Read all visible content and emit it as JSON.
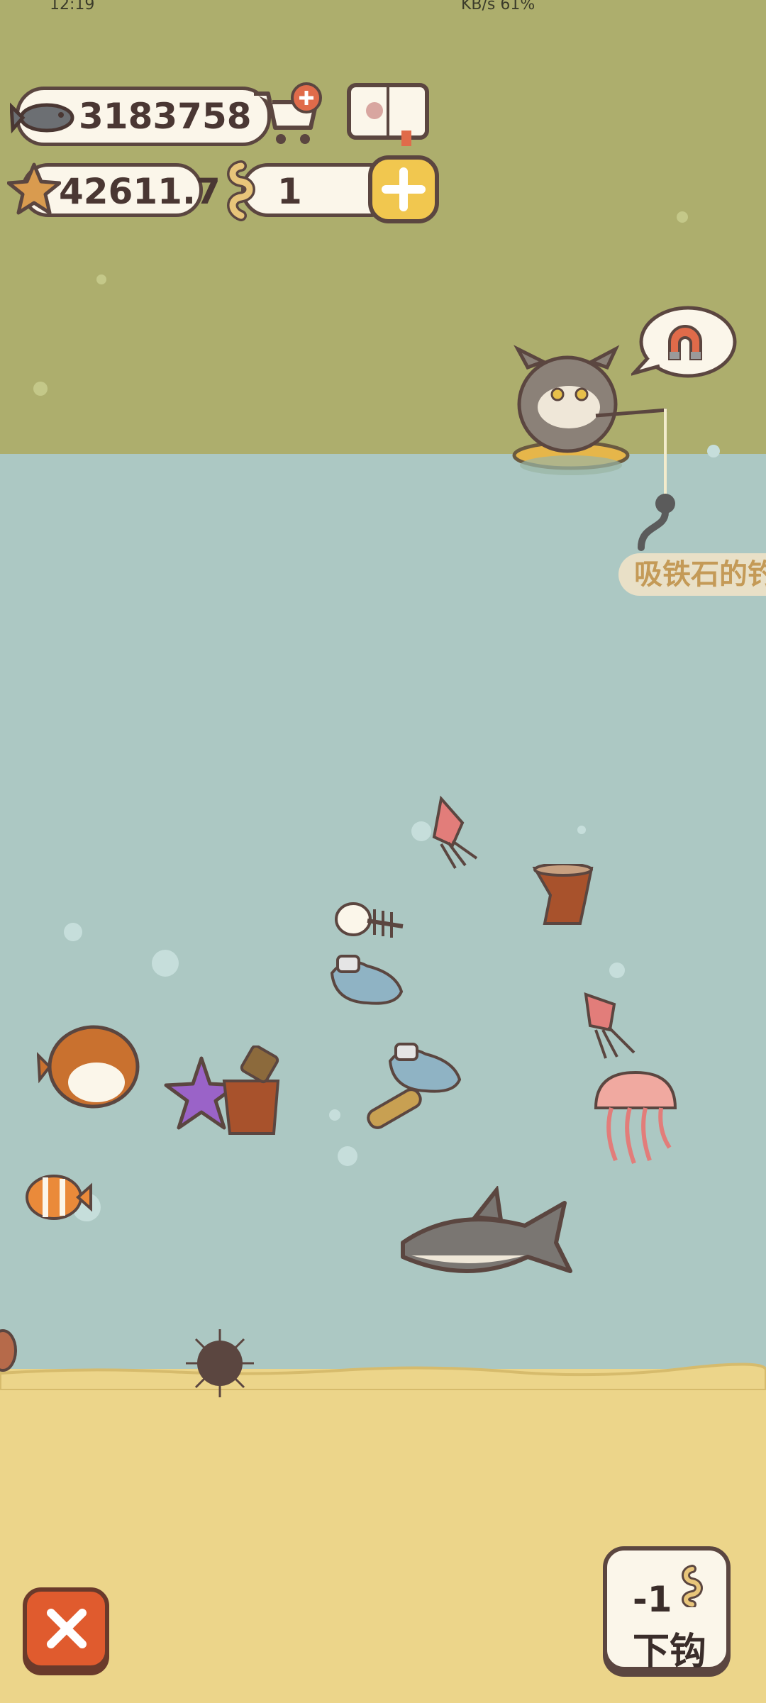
{
  "status_bar": {
    "time": "12:19",
    "right": "KB/s 61%"
  },
  "resources": {
    "fish_count": "3183758",
    "star_count": "42611.7",
    "bait_count": "1"
  },
  "hook": {
    "item_label": "吸铁石的钓"
  },
  "cast_button": {
    "cost": "-1",
    "label": "下钩"
  },
  "colors": {
    "sky": "#adae6d",
    "water": "#acc8c3",
    "sand": "#ecd58a",
    "outline": "#5b4640",
    "accent_yellow": "#f1c74f",
    "close_red": "#e05b2e"
  },
  "icons": [
    "fish-icon",
    "cart-icon",
    "encyclopedia-book-icon",
    "starfish-icon",
    "bait-worm-icon",
    "plus-icon",
    "magnet-icon",
    "close-icon"
  ]
}
